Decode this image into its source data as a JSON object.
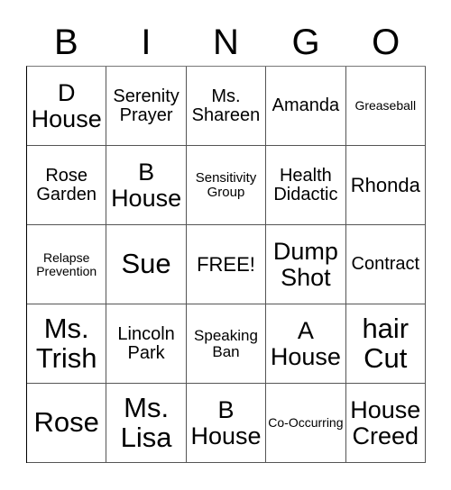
{
  "header": {
    "letters": [
      "B",
      "I",
      "N",
      "G",
      "O"
    ]
  },
  "board": {
    "cells": [
      [
        "D House",
        "Serenity Prayer",
        "Ms. Shareen",
        "Amanda",
        "Greaseball"
      ],
      [
        "Rose Garden",
        "B House",
        "Sensitivity Group",
        "Health Didactic",
        "Rhonda"
      ],
      [
        "Relapse Prevention",
        "Sue",
        "FREE!",
        "Dump Shot",
        "Contract"
      ],
      [
        "Ms. Trish",
        "Lincoln Park",
        "Speaking Ban",
        "A House",
        "hair Cut"
      ],
      [
        "Rose",
        "Ms. Lisa",
        "B House",
        "Co-Occurring",
        "House Creed"
      ]
    ]
  }
}
